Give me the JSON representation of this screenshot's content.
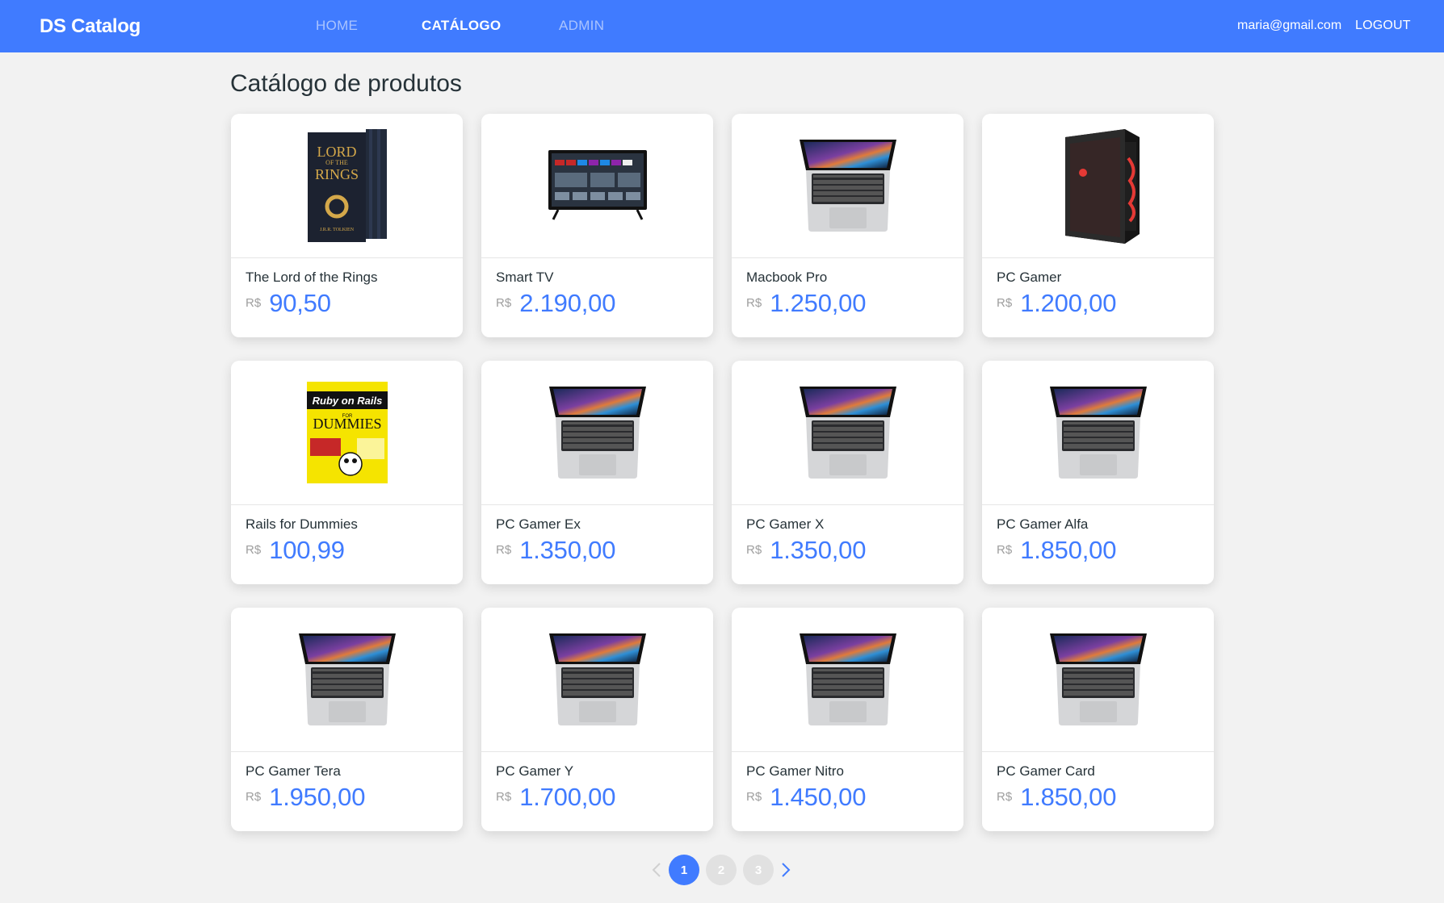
{
  "navbar": {
    "brand": "DS Catalog",
    "links": [
      {
        "label": "HOME"
      },
      {
        "label": "CATÁLOGO"
      },
      {
        "label": "ADMIN"
      }
    ],
    "active": "CATÁLOGO",
    "user_email": "maria@gmail.com",
    "logout_label": "LOGOUT"
  },
  "page": {
    "title": "Catálogo de produtos"
  },
  "products": [
    {
      "name": "The Lord of the Rings",
      "currency": "R$",
      "price": "90,50",
      "image": "book"
    },
    {
      "name": "Smart TV",
      "currency": "R$",
      "price": "2.190,00",
      "image": "tv"
    },
    {
      "name": "Macbook Pro",
      "currency": "R$",
      "price": "1.250,00",
      "image": "laptop"
    },
    {
      "name": "PC Gamer",
      "currency": "R$",
      "price": "1.200,00",
      "image": "pc-tower"
    },
    {
      "name": "Rails for Dummies",
      "currency": "R$",
      "price": "100,99",
      "image": "dummies-book"
    },
    {
      "name": "PC Gamer Ex",
      "currency": "R$",
      "price": "1.350,00",
      "image": "laptop"
    },
    {
      "name": "PC Gamer X",
      "currency": "R$",
      "price": "1.350,00",
      "image": "laptop"
    },
    {
      "name": "PC Gamer Alfa",
      "currency": "R$",
      "price": "1.850,00",
      "image": "laptop"
    },
    {
      "name": "PC Gamer Tera",
      "currency": "R$",
      "price": "1.950,00",
      "image": "laptop"
    },
    {
      "name": "PC Gamer Y",
      "currency": "R$",
      "price": "1.700,00",
      "image": "laptop"
    },
    {
      "name": "PC Gamer Nitro",
      "currency": "R$",
      "price": "1.450,00",
      "image": "laptop"
    },
    {
      "name": "PC Gamer Card",
      "currency": "R$",
      "price": "1.850,00",
      "image": "laptop"
    }
  ],
  "book_cover_text": {
    "line1": "LORD",
    "line2": "OF THE",
    "line3": "RINGS",
    "author": "J.R.R. TOLKIEN"
  },
  "dummies_cover_text": {
    "title": "Ruby on Rails",
    "for": "FOR",
    "brand": "DUMMIES"
  },
  "pagination": {
    "pages": [
      "1",
      "2",
      "3"
    ],
    "current": "1",
    "prev_icon": "chevron-left-icon",
    "next_icon": "chevron-right-icon"
  },
  "colors": {
    "primary": "#407bff",
    "background": "#f2f2f2",
    "text": "#263238",
    "muted": "#9e9e9e"
  }
}
